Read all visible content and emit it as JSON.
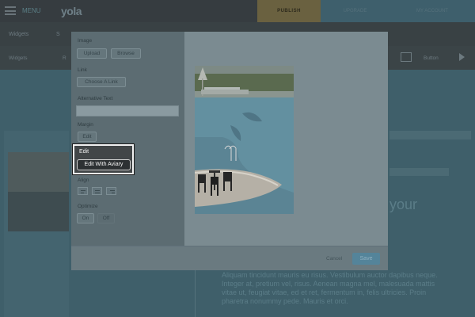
{
  "topbar": {
    "menu_label": "MENU",
    "logo": "yola",
    "publish_label": "PUBLISH",
    "upgrade_label": "UPGRADE",
    "account_label": "MY ACCOUNT"
  },
  "subbar": {
    "tab1": "Widgets",
    "tab2": "S"
  },
  "toolbar": {
    "item1": "Widgets",
    "item2": "R",
    "button_label": "Button"
  },
  "background": {
    "corner_text": "",
    "left_label1": "",
    "left_label2": "",
    "heading": "your",
    "paragraph": "Aliquam tincidunt mauris eu risus. Vestibulum auctor dapibus neque. Integer at, pretium vel, risus. Aenean magna mel, malesuada mattis vitae ut, feugiat vitae, ed et ret, fermentum in, felis ultricies. Proin pharetra nonummy pede. Mauris et orci."
  },
  "modal": {
    "image_label": "Image",
    "upload_label": "Upload",
    "browse_label": "Browse",
    "link_label": "Link",
    "choose_link_label": "Choose A Link",
    "alt_text_label": "Alternative Text",
    "alt_text_value": "",
    "margin_label": "Margin",
    "margin_edit_label": "Edit",
    "edit_label": "Edit",
    "edit_with_aviary_label": "Edit With Aviary",
    "align_label": "Align",
    "optimize_label": "Optimize",
    "on_label": "On",
    "off_label": "Off",
    "cancel_label": "Cancel",
    "save_label": "Save"
  },
  "colors": {
    "highlight_border": "#f2f2f2",
    "save_button": "#54849a",
    "publish_button": "#6a6140"
  }
}
